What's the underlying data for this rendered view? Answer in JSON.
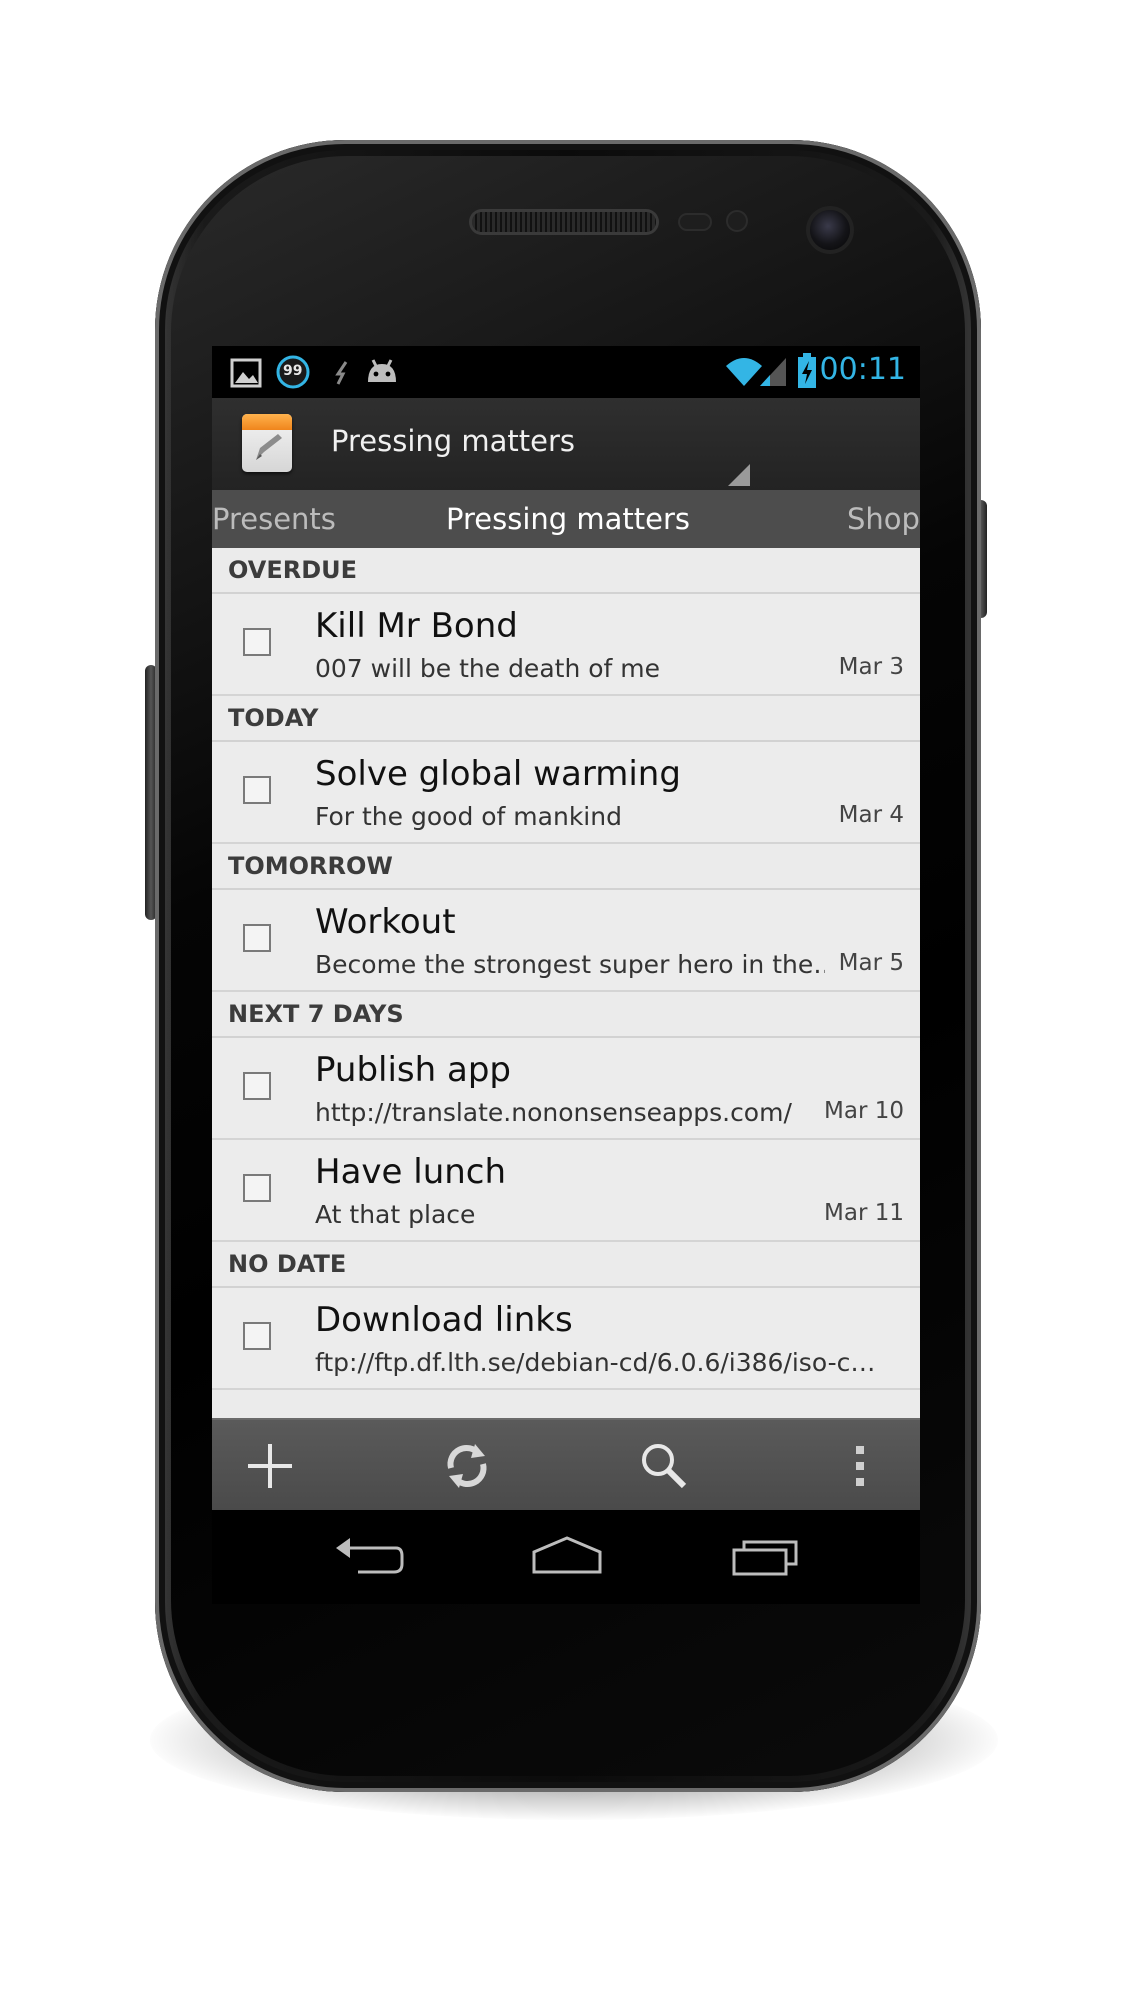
{
  "status_bar": {
    "time": "00:11",
    "notification_badge": "99",
    "icons": [
      "gallery-icon",
      "notification-99-icon",
      "usb-icon",
      "android-debug-icon",
      "wifi-icon",
      "signal-icon",
      "battery-charging-icon"
    ]
  },
  "action_bar": {
    "title": "Pressing matters",
    "app_icon": "notepad-icon"
  },
  "tabs": {
    "previous": "Presents",
    "current": "Pressing matters",
    "next": "Shop"
  },
  "sections": [
    {
      "header": "OVERDUE",
      "items": [
        {
          "title": "Kill Mr Bond",
          "note": "007 will be the death of me",
          "date": "Mar 3"
        }
      ]
    },
    {
      "header": "TODAY",
      "items": [
        {
          "title": "Solve global warming",
          "note": "For the good of mankind",
          "date": "Mar 4"
        }
      ]
    },
    {
      "header": "TOMORROW",
      "items": [
        {
          "title": "Workout",
          "note": "Become the strongest super hero in the…",
          "date": "Mar 5"
        }
      ]
    },
    {
      "header": "NEXT 7 DAYS",
      "items": [
        {
          "title": "Publish app",
          "note": "http://translate.nononsenseapps.com/",
          "date": "Mar 10"
        },
        {
          "title": "Have lunch",
          "note": "At that place",
          "date": "Mar 11"
        }
      ]
    },
    {
      "header": "NO DATE",
      "items": [
        {
          "title": "Download links",
          "note": "ftp://ftp.df.lth.se/debian-cd/6.0.6/i386/iso-c…",
          "date": ""
        }
      ]
    }
  ],
  "bottom_bar": {
    "buttons": [
      "add-icon",
      "sync-icon",
      "search-icon",
      "overflow-menu-icon"
    ]
  },
  "nav_bar": {
    "buttons": [
      "back-icon",
      "home-icon",
      "recent-apps-icon"
    ]
  },
  "colors": {
    "accent": "#33b5e5",
    "action_bar": "#2f2f2f",
    "tab_strip": "#4d4d4d",
    "list_background": "#ebebeb",
    "bottom_bar": "#525252"
  }
}
